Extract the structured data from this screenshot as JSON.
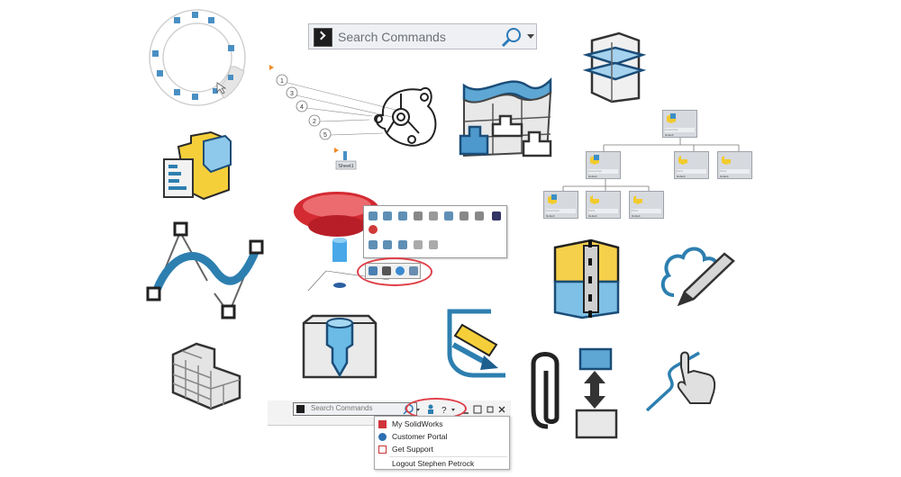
{
  "search_top": {
    "placeholder": "Search Commands",
    "icons": [
      "command-prompt-icon",
      "magnifier-icon",
      "dropdown-arrow-icon"
    ]
  },
  "search_bottom": {
    "placeholder": "Search Commands",
    "toolbar_icons": [
      "magnifier-icon",
      "dropdown-arrow-icon",
      "user-icon",
      "help-icon",
      "dropdown-arrow-icon",
      "minimize-icon",
      "tile-icon",
      "restore-icon",
      "close-icon"
    ],
    "help_label": "?"
  },
  "user_menu": {
    "items": [
      {
        "label": "My SolidWorks",
        "icon": "solidworks-logo-icon"
      },
      {
        "label": "Customer Portal",
        "icon": "globe-icon"
      },
      {
        "label": "Get Support",
        "icon": "support-icon"
      },
      {
        "label": "Logout Stephen Petrock",
        "icon": ""
      }
    ]
  },
  "balloons": {
    "labels": [
      "1",
      "3",
      "4",
      "2",
      "5"
    ],
    "sheet_label": "Sheet1"
  },
  "assembly_tree": {
    "nodes": [
      {
        "name": "Assembly1",
        "config": "Default"
      },
      {
        "name": "Assembly2",
        "config": "Default"
      },
      {
        "name": "Part1",
        "config": "Default"
      },
      {
        "name": "Part2",
        "config": "Default"
      },
      {
        "name": "Assembly3",
        "config": "Default"
      },
      {
        "name": "Part3",
        "config": "Default"
      },
      {
        "name": "Part4",
        "config": "Default"
      }
    ]
  },
  "colors": {
    "accent_blue": "#2d7fb0",
    "dark_blue": "#1d4f7a",
    "light_blue": "#8ec8ea",
    "yellow": "#f5cf3a",
    "highlight_red": "#e0404a"
  }
}
